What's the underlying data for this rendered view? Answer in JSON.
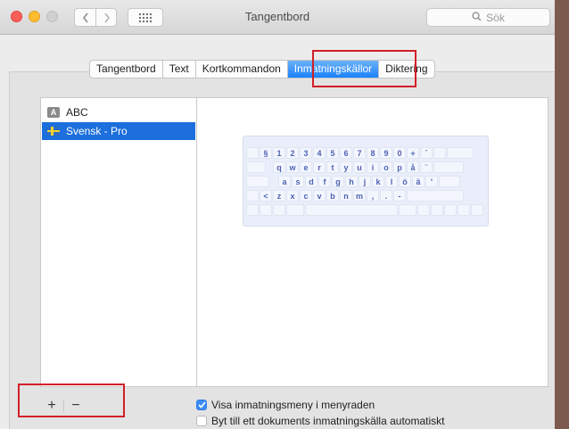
{
  "window": {
    "title": "Tangentbord"
  },
  "toolbar": {
    "back_icon": "chevron-left-icon",
    "forward_icon": "chevron-right-icon",
    "grid_icon": "grid-icon",
    "search_placeholder": "Sök",
    "search_icon": "search-icon"
  },
  "tabs": [
    {
      "label": "Tangentbord"
    },
    {
      "label": "Text"
    },
    {
      "label": "Kortkommandon"
    },
    {
      "label": "Inmatningskällor",
      "selected": true
    },
    {
      "label": "Diktering"
    }
  ],
  "sources": [
    {
      "label": "ABC",
      "icon": "A",
      "selected": false
    },
    {
      "label": "Svensk - Pro",
      "icon": "swedish-flag-icon",
      "selected": true
    }
  ],
  "keyboard": {
    "rows": [
      [
        "§",
        "1",
        "2",
        "3",
        "4",
        "5",
        "6",
        "7",
        "8",
        "9",
        "0",
        "+",
        "´"
      ],
      [
        "q",
        "w",
        "e",
        "r",
        "t",
        "y",
        "u",
        "i",
        "o",
        "p",
        "å",
        "¨"
      ],
      [
        "a",
        "s",
        "d",
        "f",
        "g",
        "h",
        "j",
        "k",
        "l",
        "ö",
        "ä",
        "'"
      ],
      [
        "<",
        "z",
        "x",
        "c",
        "v",
        "b",
        "n",
        "m",
        ",",
        ".",
        "-"
      ]
    ]
  },
  "list_controls": {
    "add": "+",
    "remove": "−"
  },
  "options": {
    "show_menu": {
      "label": "Visa inmatningsmeny i menyraden",
      "checked": true
    },
    "auto_switch": {
      "label": "Byt till ett dokuments inmatningskälla automatiskt",
      "checked": false
    }
  },
  "colors": {
    "accent": "#1c6fdc",
    "highlight_box": "#d21f27"
  }
}
